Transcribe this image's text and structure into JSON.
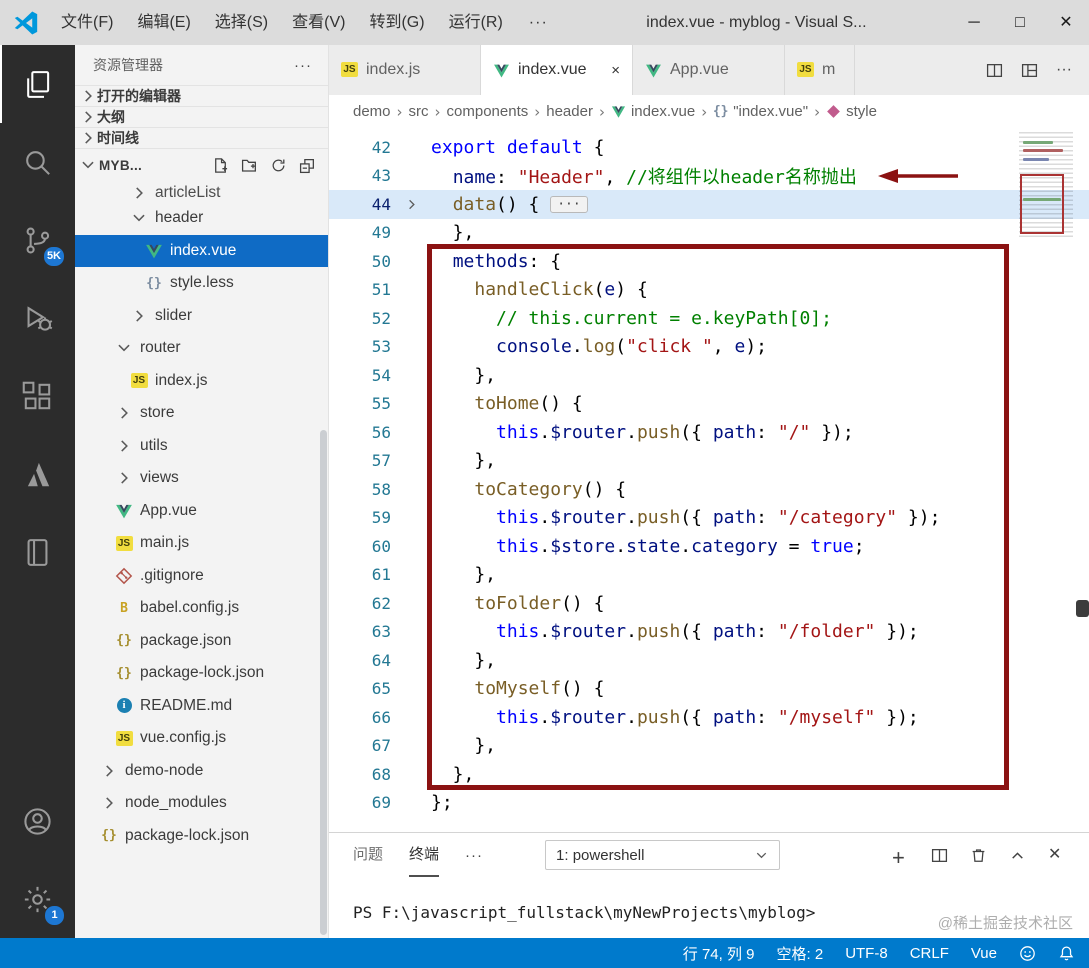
{
  "title_bar": {
    "menus": [
      "文件(F)",
      "编辑(E)",
      "选择(S)",
      "查看(V)",
      "转到(G)",
      "运行(R)"
    ],
    "more_label": "···",
    "title": "index.vue - myblog - Visual S...",
    "window_controls": {
      "minimize": "─",
      "maximize": "□",
      "close": "✕"
    }
  },
  "activity_bar": {
    "items": [
      {
        "name": "explorer",
        "active": true
      },
      {
        "name": "search"
      },
      {
        "name": "source-control",
        "badge": "5K"
      },
      {
        "name": "run-debug"
      },
      {
        "name": "extensions"
      },
      {
        "name": "azure"
      },
      {
        "name": "notebook"
      }
    ],
    "bottom_items": [
      {
        "name": "account"
      },
      {
        "name": "settings",
        "badge": "1"
      }
    ]
  },
  "sidebar": {
    "title": "资源管理器",
    "more_label": "···",
    "sections": [
      {
        "label": "打开的编辑器"
      },
      {
        "label": "大纲"
      },
      {
        "label": "时间线"
      }
    ],
    "workspace": {
      "label": "MYB...",
      "actions": [
        "new-file",
        "new-folder",
        "refresh",
        "collapse-all"
      ]
    },
    "tree": [
      {
        "name": "articleList",
        "type": "folder",
        "state": "collapsed",
        "indent": 3,
        "cut": true
      },
      {
        "name": "header",
        "type": "folder",
        "state": "expanded",
        "indent": 3
      },
      {
        "name": "index.vue",
        "type": "file",
        "icon": "vue",
        "indent": 4,
        "selected": true
      },
      {
        "name": "style.less",
        "type": "file",
        "icon": "braces",
        "indent": 4
      },
      {
        "name": "slider",
        "type": "folder",
        "state": "collapsed",
        "indent": 3
      },
      {
        "name": "router",
        "type": "folder",
        "state": "expanded",
        "indent": 2
      },
      {
        "name": "index.js",
        "type": "file",
        "icon": "js",
        "indent": 3
      },
      {
        "name": "store",
        "type": "folder",
        "state": "collapsed",
        "indent": 2
      },
      {
        "name": "utils",
        "type": "folder",
        "state": "collapsed",
        "indent": 2
      },
      {
        "name": "views",
        "type": "folder",
        "state": "collapsed",
        "indent": 2
      },
      {
        "name": "App.vue",
        "type": "file",
        "icon": "vue",
        "indent": 2
      },
      {
        "name": "main.js",
        "type": "file",
        "icon": "js",
        "indent": 2
      },
      {
        "name": ".gitignore",
        "type": "file",
        "icon": "git",
        "indent": 2
      },
      {
        "name": "babel.config.js",
        "type": "file",
        "icon": "babel",
        "indent": 2
      },
      {
        "name": "package.json",
        "type": "file",
        "icon": "json",
        "indent": 2
      },
      {
        "name": "package-lock.json",
        "type": "file",
        "icon": "json",
        "indent": 2
      },
      {
        "name": "README.md",
        "type": "file",
        "icon": "info",
        "indent": 2
      },
      {
        "name": "vue.config.js",
        "type": "file",
        "icon": "js",
        "indent": 2
      },
      {
        "name": "demo-node",
        "type": "folder",
        "state": "collapsed",
        "indent": 1
      },
      {
        "name": "node_modules",
        "type": "folder",
        "state": "collapsed",
        "indent": 1
      },
      {
        "name": "package-lock.json",
        "type": "file",
        "icon": "json",
        "indent": 1
      }
    ]
  },
  "editor": {
    "tabs": [
      {
        "label": "index.js",
        "icon": "js"
      },
      {
        "label": "index.vue",
        "icon": "vue",
        "active": true,
        "close": "×"
      },
      {
        "label": "App.vue",
        "icon": "vue"
      },
      {
        "label": "m",
        "icon": "js",
        "truncated": true
      }
    ],
    "tab_actions": [
      "split-editor",
      "editor-layout",
      "more-actions"
    ],
    "tab_more_label": "···",
    "breadcrumb": [
      {
        "label": "demo"
      },
      {
        "label": "src"
      },
      {
        "label": "components"
      },
      {
        "label": "header"
      },
      {
        "label": "index.vue",
        "icon": "vue"
      },
      {
        "label": "\"index.vue\"",
        "icon": "braces"
      },
      {
        "label": "style",
        "icon": "symbol"
      }
    ],
    "lines": [
      {
        "num": 42,
        "t": [
          [
            "k",
            "export"
          ],
          [
            "p",
            " "
          ],
          [
            "k",
            "default"
          ],
          [
            "p",
            " {"
          ]
        ]
      },
      {
        "num": 43,
        "t": [
          [
            "p",
            "  "
          ],
          [
            "n",
            "name"
          ],
          [
            "p",
            ": "
          ],
          [
            "s",
            "\"Header\""
          ],
          [
            "p",
            ", "
          ],
          [
            "c",
            "//将组件以header名称抛出"
          ]
        ],
        "arrow": true
      },
      {
        "num": 44,
        "t": [
          [
            "p",
            "  "
          ],
          [
            "f",
            "data"
          ],
          [
            "p",
            "() { "
          ],
          [
            "d",
            "···"
          ]
        ],
        "hl": true,
        "fold": true
      },
      {
        "num": 49,
        "t": [
          [
            "p",
            "  },"
          ]
        ]
      },
      {
        "num": 50,
        "t": [
          [
            "p",
            "  "
          ],
          [
            "n",
            "methods"
          ],
          [
            "p",
            ": {"
          ]
        ]
      },
      {
        "num": 51,
        "t": [
          [
            "p",
            "    "
          ],
          [
            "f",
            "handleClick"
          ],
          [
            "p",
            "("
          ],
          [
            "n",
            "e"
          ],
          [
            "p",
            ") {"
          ]
        ]
      },
      {
        "num": 52,
        "t": [
          [
            "p",
            "      "
          ],
          [
            "c",
            "// this.current = e.keyPath[0];"
          ]
        ]
      },
      {
        "num": 53,
        "t": [
          [
            "p",
            "      "
          ],
          [
            "n",
            "console"
          ],
          [
            "p",
            "."
          ],
          [
            "f",
            "log"
          ],
          [
            "p",
            "("
          ],
          [
            "s",
            "\"click \""
          ],
          [
            "p",
            ", "
          ],
          [
            "n",
            "e"
          ],
          [
            "p",
            ");"
          ]
        ]
      },
      {
        "num": 54,
        "t": [
          [
            "p",
            "    },"
          ]
        ]
      },
      {
        "num": 55,
        "t": [
          [
            "p",
            "    "
          ],
          [
            "f",
            "toHome"
          ],
          [
            "p",
            "() {"
          ]
        ]
      },
      {
        "num": 56,
        "t": [
          [
            "p",
            "      "
          ],
          [
            "k",
            "this"
          ],
          [
            "p",
            "."
          ],
          [
            "n",
            "$router"
          ],
          [
            "p",
            "."
          ],
          [
            "f",
            "push"
          ],
          [
            "p",
            "({ "
          ],
          [
            "n",
            "path"
          ],
          [
            "p",
            ": "
          ],
          [
            "s",
            "\"/\""
          ],
          [
            "p",
            " });"
          ]
        ]
      },
      {
        "num": 57,
        "t": [
          [
            "p",
            "    },"
          ]
        ]
      },
      {
        "num": 58,
        "t": [
          [
            "p",
            "    "
          ],
          [
            "f",
            "toCategory"
          ],
          [
            "p",
            "() {"
          ]
        ]
      },
      {
        "num": 59,
        "t": [
          [
            "p",
            "      "
          ],
          [
            "k",
            "this"
          ],
          [
            "p",
            "."
          ],
          [
            "n",
            "$router"
          ],
          [
            "p",
            "."
          ],
          [
            "f",
            "push"
          ],
          [
            "p",
            "({ "
          ],
          [
            "n",
            "path"
          ],
          [
            "p",
            ": "
          ],
          [
            "s",
            "\"/category\""
          ],
          [
            "p",
            " });"
          ]
        ]
      },
      {
        "num": 60,
        "t": [
          [
            "p",
            "      "
          ],
          [
            "k",
            "this"
          ],
          [
            "p",
            "."
          ],
          [
            "n",
            "$store"
          ],
          [
            "p",
            "."
          ],
          [
            "n",
            "state"
          ],
          [
            "p",
            "."
          ],
          [
            "n",
            "category"
          ],
          [
            "p",
            " = "
          ],
          [
            "k",
            "true"
          ],
          [
            "p",
            ";"
          ]
        ]
      },
      {
        "num": 61,
        "t": [
          [
            "p",
            "    },"
          ]
        ]
      },
      {
        "num": 62,
        "t": [
          [
            "p",
            "    "
          ],
          [
            "f",
            "toFolder"
          ],
          [
            "p",
            "() {"
          ]
        ]
      },
      {
        "num": 63,
        "t": [
          [
            "p",
            "      "
          ],
          [
            "k",
            "this"
          ],
          [
            "p",
            "."
          ],
          [
            "n",
            "$router"
          ],
          [
            "p",
            "."
          ],
          [
            "f",
            "push"
          ],
          [
            "p",
            "({ "
          ],
          [
            "n",
            "path"
          ],
          [
            "p",
            ": "
          ],
          [
            "s",
            "\"/folder\""
          ],
          [
            "p",
            " });"
          ]
        ]
      },
      {
        "num": 64,
        "t": [
          [
            "p",
            "    },"
          ]
        ]
      },
      {
        "num": 65,
        "t": [
          [
            "p",
            "    "
          ],
          [
            "f",
            "toMyself"
          ],
          [
            "p",
            "() {"
          ]
        ]
      },
      {
        "num": 66,
        "t": [
          [
            "p",
            "      "
          ],
          [
            "k",
            "this"
          ],
          [
            "p",
            "."
          ],
          [
            "n",
            "$router"
          ],
          [
            "p",
            "."
          ],
          [
            "f",
            "push"
          ],
          [
            "p",
            "({ "
          ],
          [
            "n",
            "path"
          ],
          [
            "p",
            ": "
          ],
          [
            "s",
            "\"/myself\""
          ],
          [
            "p",
            " });"
          ]
        ]
      },
      {
        "num": 67,
        "t": [
          [
            "p",
            "    },"
          ]
        ]
      },
      {
        "num": 68,
        "t": [
          [
            "p",
            "  },"
          ]
        ]
      },
      {
        "num": 69,
        "t": [
          [
            "p",
            "};"
          ]
        ]
      }
    ],
    "annotations": {
      "box_lines": "50-68",
      "arrow_line": 43
    }
  },
  "panel": {
    "tabs": [
      {
        "label": "问题"
      },
      {
        "label": "终端",
        "active": true
      }
    ],
    "more_label": "···",
    "shell_selector": "1: powershell",
    "actions": [
      "new-terminal",
      "split-panel",
      "kill-terminal",
      "maximize-panel",
      "close-panel"
    ],
    "terminal_prompt": "PS F:\\javascript_fullstack\\myNewProjects\\myblog>"
  },
  "watermark": "@稀土掘金技术社区",
  "status_bar": {
    "items": [
      "行 74, 列 9",
      "空格: 2",
      "UTF-8",
      "CRLF",
      "Vue"
    ],
    "icons": [
      "feedback",
      "bell"
    ]
  },
  "colors": {
    "accent": "#007acc",
    "selection": "#0f6bc5",
    "annotation": "#8b1212",
    "badge": "#1d77d3"
  }
}
